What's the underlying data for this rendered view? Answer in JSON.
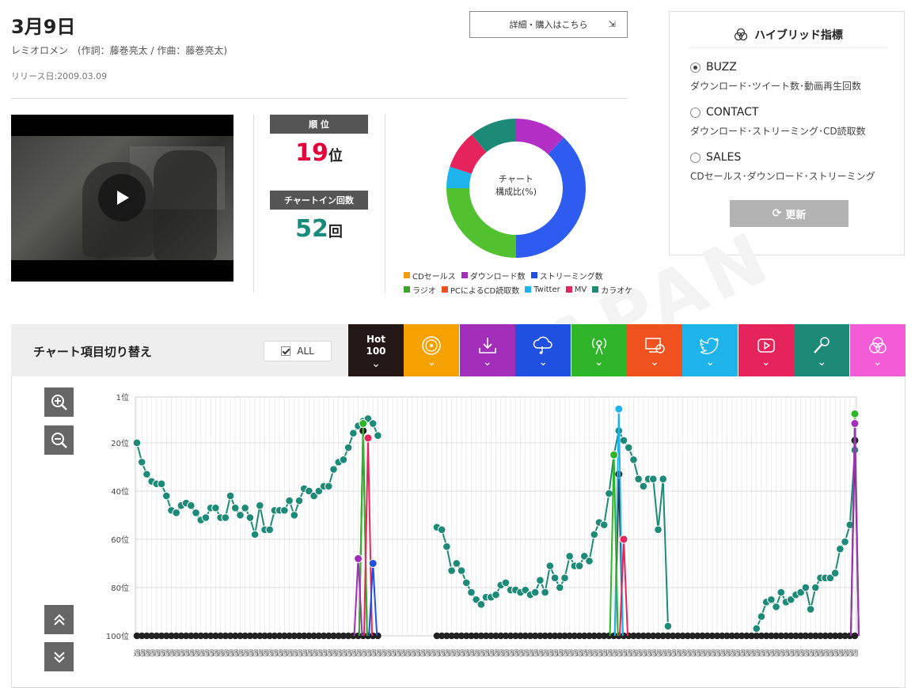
{
  "song": {
    "title": "3月9日",
    "artist_line": "レミオロメン　(作詞：藤巻亮太 / 作曲：藤巻亮太)",
    "release": "リリース日:2009.03.09"
  },
  "detail_button": {
    "label": "詳細・購入はこちら",
    "arrow": "⇲"
  },
  "hybrid": {
    "title": "ハイブリッド指標",
    "options": [
      {
        "label": "BUZZ",
        "desc": "ダウンロード･ツイート数･動画再生回数",
        "selected": true
      },
      {
        "label": "CONTACT",
        "desc": "ダウンロード･ストリーミング･CD読取数",
        "selected": false
      },
      {
        "label": "SALES",
        "desc": "CDセールス･ダウンロード･ストリーミング",
        "selected": false
      }
    ],
    "update_label": "更新"
  },
  "stats": {
    "rank_label": "順 位",
    "rank_value": "19",
    "rank_suffix": "位",
    "count_label": "チャートイン回数",
    "count_value": "52",
    "count_suffix": "回",
    "rank_color": "#e4003a",
    "count_color": "#1a8a7a"
  },
  "donut": {
    "center_line1": "チャート",
    "center_line2": "構成比(%)",
    "slices": [
      {
        "name": "ダウンロード数",
        "value": 12,
        "color": "#b22ec4"
      },
      {
        "name": "ストリーミング数",
        "value": 38,
        "color": "#2f5cf0"
      },
      {
        "name": "ラジオ",
        "value": 25,
        "color": "#51c12f"
      },
      {
        "name": "Twitter",
        "value": 5,
        "color": "#1fb3ec"
      },
      {
        "name": "MV",
        "value": 9,
        "color": "#e4245a"
      },
      {
        "name": "カラオケ",
        "value": 11,
        "color": "#1d8a77"
      }
    ]
  },
  "legend": [
    [
      {
        "name": "CDセールス",
        "color": "#f39c12"
      },
      {
        "name": "ダウンロード数",
        "color": "#a12fb9"
      },
      {
        "name": "ストリーミング数",
        "color": "#2050e0"
      }
    ],
    [
      {
        "name": "ラジオ",
        "color": "#3aa52a"
      },
      {
        "name": "PCによるCD読取数",
        "color": "#f0521f"
      },
      {
        "name": "Twitter",
        "color": "#1fb3ec"
      },
      {
        "name": "MV",
        "color": "#e4245a"
      },
      {
        "name": "カラオケ",
        "color": "#1d8a77"
      }
    ]
  ],
  "switcher": {
    "title": "チャート項目切り替え",
    "all_label": "ALL",
    "hot_line1": "Hot",
    "hot_line2": "100",
    "tabs": [
      {
        "icon": "hot100",
        "color": "#231815"
      },
      {
        "icon": "cd-sales-icon",
        "color": "#f5a200"
      },
      {
        "icon": "download-icon",
        "color": "#a12fb9"
      },
      {
        "icon": "streaming-icon",
        "color": "#2050e0"
      },
      {
        "icon": "radio-icon",
        "color": "#2fb52a"
      },
      {
        "icon": "pc-cd-read-icon",
        "color": "#f0521f"
      },
      {
        "icon": "twitter-icon",
        "color": "#1fb3ec"
      },
      {
        "icon": "mv-icon",
        "color": "#e4245a"
      },
      {
        "icon": "karaoke-icon",
        "color": "#1d8a77"
      },
      {
        "icon": "hybrid-icon",
        "color": "#f45bd6"
      }
    ]
  },
  "chart_data": {
    "type": "line",
    "y_inverted": true,
    "ylim": [
      1,
      100
    ],
    "yticks": [
      "1位",
      "20位",
      "40位",
      "60位",
      "80位",
      "100位"
    ],
    "x_label_suffix": "週",
    "x_tick_numbers": "28 29 30 31 ... 28 29 30 (weekly, partially illegible)",
    "series": [
      {
        "name": "カラオケ",
        "color": "#1d8a77",
        "values": [
          20,
          28,
          33,
          36,
          37,
          37,
          42,
          48,
          49,
          46,
          45,
          46,
          49,
          52,
          51,
          47,
          47,
          51,
          51,
          42,
          47,
          50,
          47,
          51,
          58,
          46,
          56,
          56,
          48,
          48,
          48,
          44,
          50,
          44,
          39,
          40,
          42,
          40,
          38,
          38,
          31,
          28,
          27,
          22,
          16,
          13,
          11,
          10,
          12,
          17,
          null,
          null,
          null,
          null,
          null,
          null,
          null,
          null,
          null,
          null,
          null,
          55,
          56,
          63,
          73,
          70,
          73,
          78,
          82,
          85,
          87,
          84,
          84,
          83,
          79,
          78,
          81,
          81,
          82,
          81,
          83,
          82,
          77,
          82,
          71,
          76,
          80,
          76,
          67,
          71,
          71,
          67,
          69,
          58,
          53,
          54,
          41,
          25,
          15,
          19,
          22,
          27,
          35,
          38,
          35,
          35,
          56,
          35,
          96,
          null,
          null,
          null,
          null,
          null,
          null,
          null,
          null,
          null,
          null,
          null,
          null,
          null,
          null,
          null,
          null,
          null,
          97,
          92,
          86,
          85,
          88,
          82,
          86,
          85,
          83,
          82,
          80,
          89,
          80,
          76,
          76,
          76,
          74,
          64,
          61,
          54,
          23
        ]
      }
    ]
  },
  "nav": {
    "zoom_in": "zoom-in",
    "zoom_out": "zoom-out",
    "scroll_up": "scroll-up",
    "scroll_down": "scroll-down"
  }
}
